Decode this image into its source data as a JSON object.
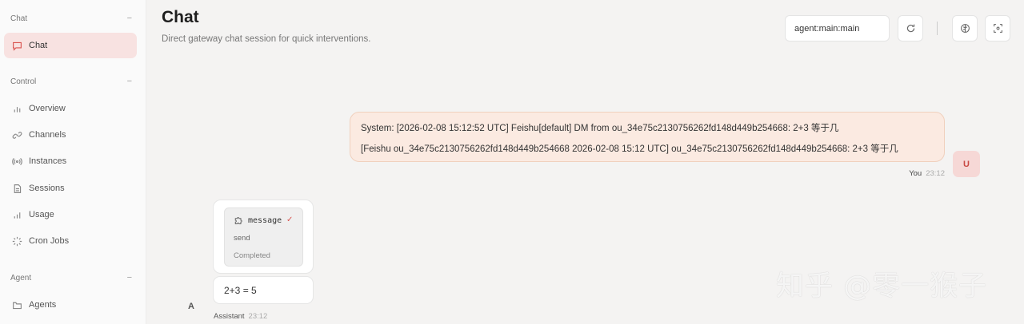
{
  "sidebar": {
    "sections": [
      {
        "label": "Chat",
        "collapse": "−"
      },
      {
        "label": "Control",
        "collapse": "−"
      },
      {
        "label": "Agent",
        "collapse": "−"
      }
    ],
    "items": [
      {
        "label": "Chat",
        "icon": "chat-bubble-icon",
        "active": true
      },
      {
        "label": "Overview",
        "icon": "bar-chart-icon"
      },
      {
        "label": "Channels",
        "icon": "link-icon"
      },
      {
        "label": "Instances",
        "icon": "broadcast-icon"
      },
      {
        "label": "Sessions",
        "icon": "document-icon"
      },
      {
        "label": "Usage",
        "icon": "bar-chart-icon"
      },
      {
        "label": "Cron Jobs",
        "icon": "loader-icon"
      },
      {
        "label": "Agents",
        "icon": "folder-icon"
      }
    ]
  },
  "header": {
    "title": "Chat",
    "subtitle": "Direct gateway chat session for quick interventions.",
    "session_value": "agent:main:main",
    "buttons": [
      "refresh-icon",
      "brain-icon",
      "focus-icon"
    ]
  },
  "messages": {
    "user": {
      "lines": [
        "System: [2026-02-08 15:12:52 UTC] Feishu[default] DM from ou_34e75c2130756262fd148d449b254668: 2+3 等于几",
        "[Feishu ou_34e75c2130756262fd148d449b254668 2026-02-08 15:12 UTC] ou_34e75c2130756262fd148d449b254668: 2+3 等于几"
      ],
      "avatar": "U",
      "sender": "You",
      "time": "23:12"
    },
    "assistant": {
      "tool": {
        "name": "message",
        "check": "✓",
        "action": "send",
        "status": "Completed"
      },
      "answer": "2+3 = 5",
      "avatar": "A",
      "sender": "Assistant",
      "time": "23:12"
    }
  },
  "watermark": "知乎 @零一猴子",
  "colors": {
    "accent": "#d9534f",
    "active_bg": "#f8e2e1",
    "user_bubble": "#fbeae1"
  }
}
